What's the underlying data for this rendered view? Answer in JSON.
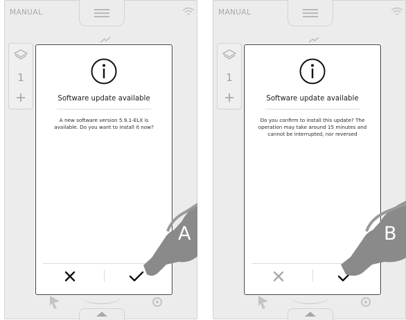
{
  "panels": [
    {
      "id": "A",
      "mode_label": "MANUAL",
      "side_number": "1",
      "dialog": {
        "title": "Software update available",
        "message": "A new software version 5.9.1-ELX is available. Do you want to install it now?",
        "cancel_icon": "x-icon",
        "confirm_icon": "check-icon"
      },
      "hand_label": "A",
      "cancel_color": "#111111"
    },
    {
      "id": "B",
      "mode_label": "MANUAL",
      "side_number": "1",
      "dialog": {
        "title": "Software update available",
        "message": "Do you confirm to install this update? The operation may take around 15 minutes and cannot be interrupted, nor reversed",
        "cancel_icon": "x-icon",
        "confirm_icon": "check-icon"
      },
      "hand_label": "B",
      "cancel_color": "#a8a8a8"
    }
  ],
  "colors": {
    "frame_bg": "#ececec",
    "hand_gray": "#8a8a8a",
    "muted_icon": "#b8b8b8"
  }
}
